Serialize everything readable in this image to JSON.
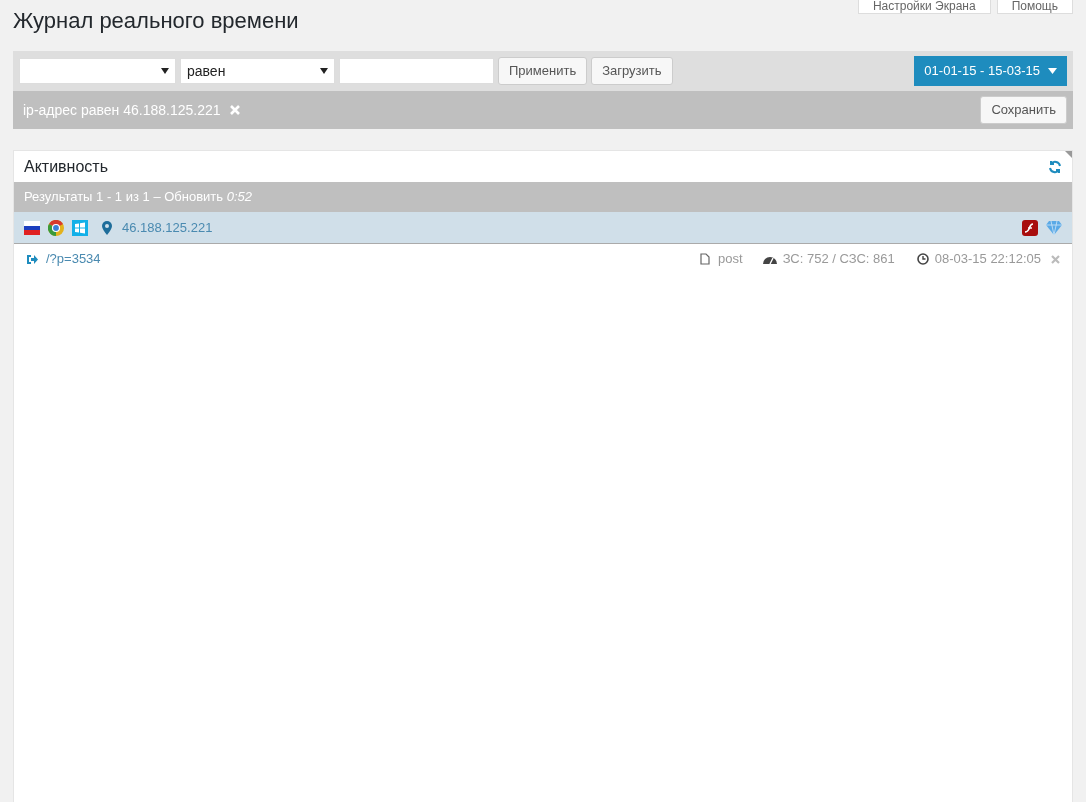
{
  "page_title": "Журнал реального времени",
  "header_buttons": [
    {
      "label": "Настройки Экрана"
    },
    {
      "label": "Помощь"
    }
  ],
  "filter": {
    "operator_select": {
      "value": "равен"
    },
    "buttons": [
      "Применить",
      "Загрузить"
    ],
    "date_range": "01-01-15 - 15-03-15"
  },
  "active_filter": {
    "text": "ip-адрес равен 46.188.125.221",
    "save_button": "Сохранить"
  },
  "panel": {
    "title": "Активность",
    "results": {
      "text": "Результаты 1 - 1 из 1 – Обновить",
      "timer": "0:52"
    },
    "visitors": [
      {
        "ip": "46.188.125.221",
        "pages": [
          {
            "url": "/?p=3534",
            "content_type": "post",
            "screen": "ЗС: 752 / СЗС: 861",
            "time": "08-03-15 22:12:05"
          }
        ]
      }
    ]
  }
}
